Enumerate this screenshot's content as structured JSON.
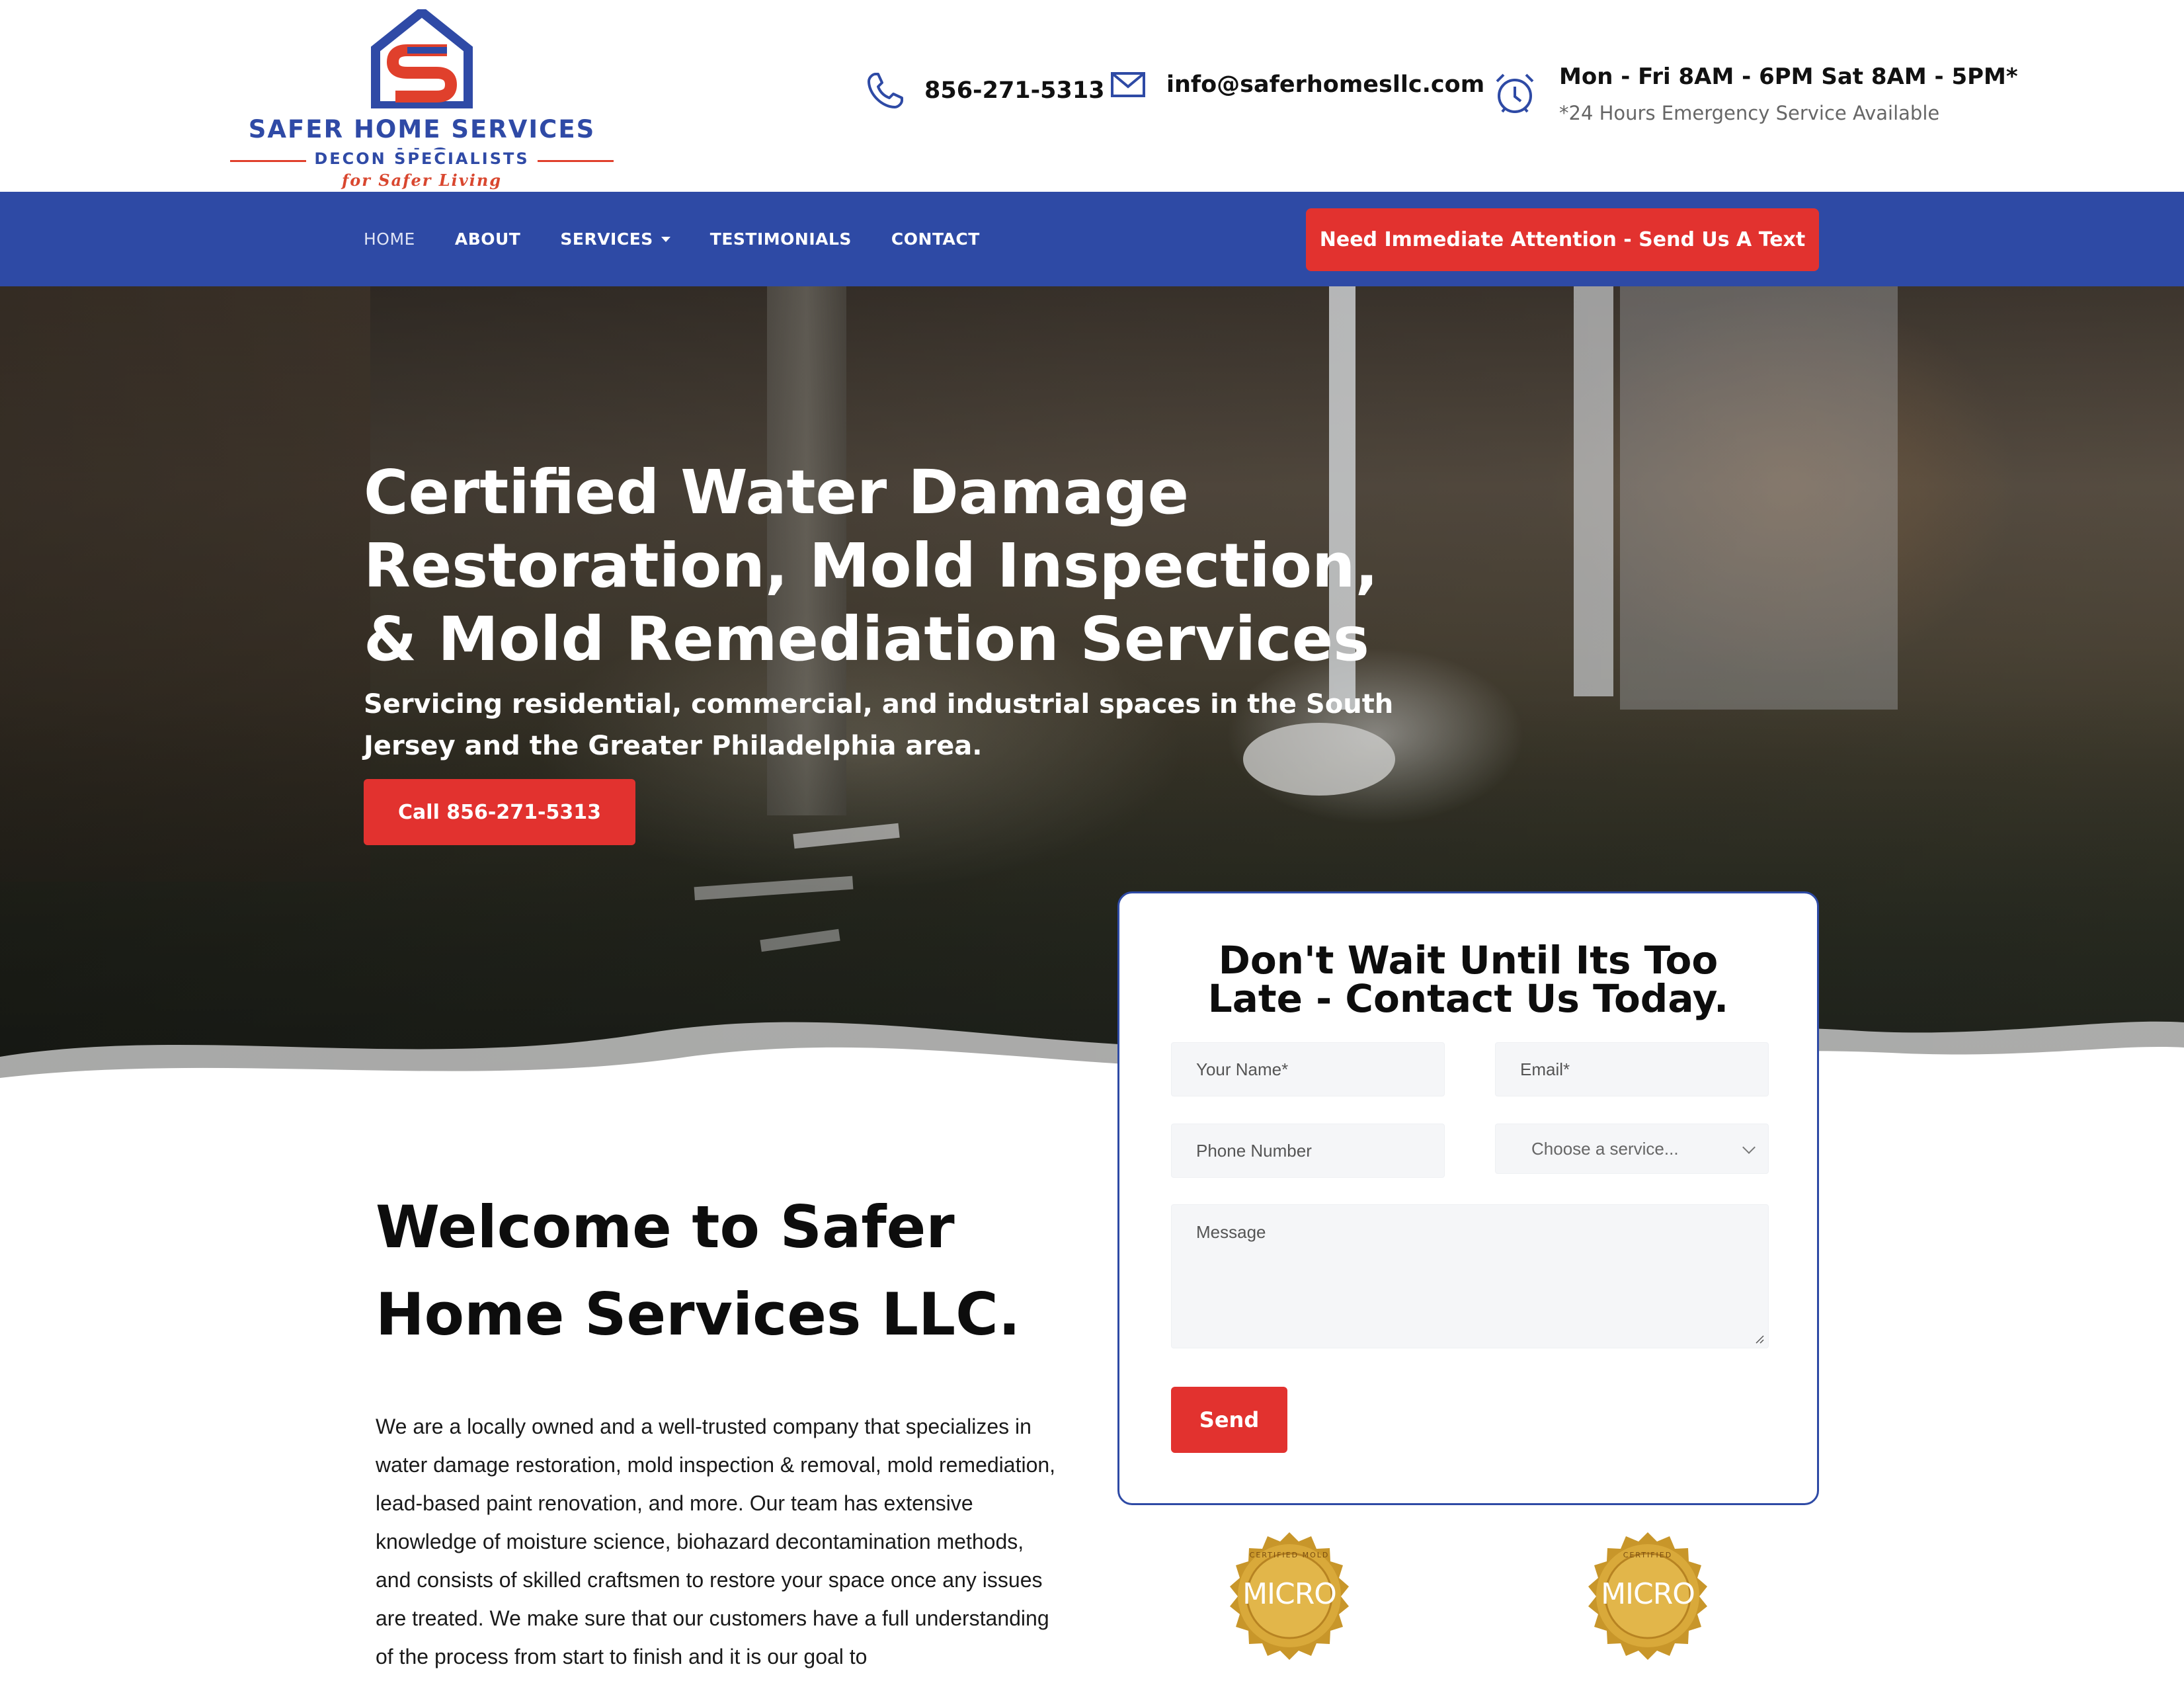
{
  "brand": {
    "name": "SAFER HOME SERVICES LLC",
    "tagline": "DECON SPECIALISTS",
    "slogan": "for Safer Living",
    "colors": {
      "primary_blue": "#2e4aa5",
      "accent_red": "#e2322f",
      "logo_orange": "#e0402c"
    }
  },
  "header": {
    "phone": "856-271-5313",
    "email": "info@saferhomesllc.com",
    "hours": "Mon - Fri 8AM - 6PM Sat 8AM - 5PM*",
    "emergency_note": "*24 Hours Emergency Service Available",
    "icons": [
      "phone-icon",
      "mail-icon",
      "alarm-clock-icon"
    ]
  },
  "nav": {
    "items": [
      {
        "label": "HOME"
      },
      {
        "label": "ABOUT"
      },
      {
        "label": "SERVICES"
      },
      {
        "label": "TESTIMONIALS"
      },
      {
        "label": "CONTACT"
      }
    ],
    "cta_label": "Need Immediate Attention - Send Us A Text"
  },
  "hero": {
    "title": "Certified Water Damage Restoration, Mold Inspection, & Mold Remediation Services",
    "subtitle": "Servicing residential, commercial, and industrial spaces in the South Jersey and the Greater Philadelphia area.",
    "button_label": "Call 856-271-5313"
  },
  "welcome": {
    "title": "Welcome to Safer Home Services LLC.",
    "body": "We are a locally owned and a well-trusted company that specializes in water damage restoration, mold inspection & removal, mold remediation, lead-based paint renovation, and more. Our team has extensive knowledge of moisture science, biohazard decontamination methods, and consists of skilled craftsmen to restore your space once any issues are treated. We make sure that our customers have a full understanding of the process from start to finish and it is our goal to"
  },
  "contact_form": {
    "heading": "Don't Wait Until Its Too Late - Contact Us Today.",
    "name_placeholder": "Your Name*",
    "email_placeholder": "Email*",
    "phone_placeholder": "Phone Number",
    "service_placeholder": "Choose a service...",
    "message_placeholder": "Message",
    "send_label": "Send"
  },
  "badges": [
    {
      "label": "MICRO",
      "ring_text": "CERTIFIED MOLD"
    },
    {
      "label": "MICRO",
      "ring_text": "CERTIFIED"
    }
  ]
}
